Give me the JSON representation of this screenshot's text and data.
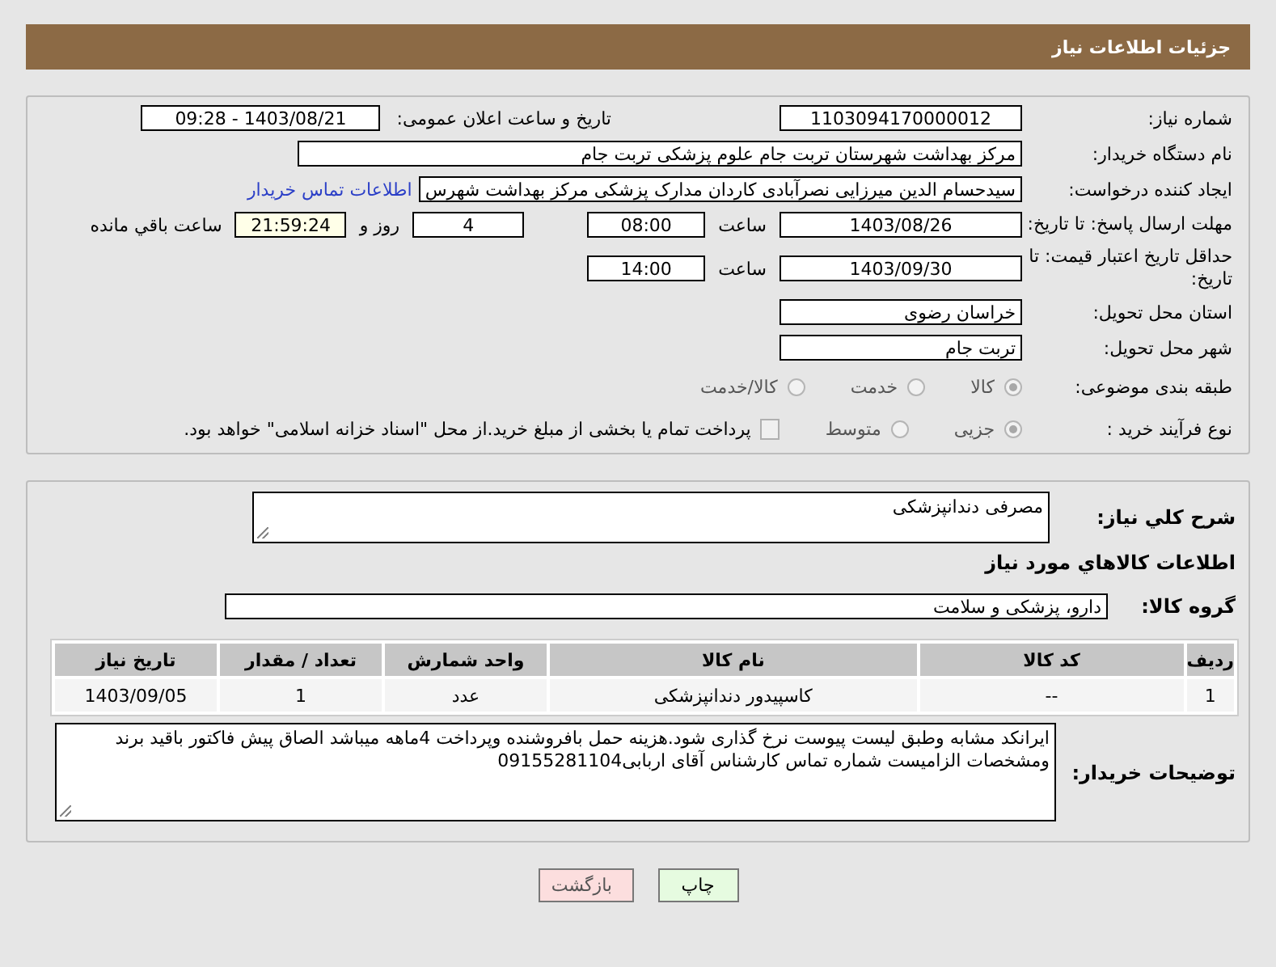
{
  "header": {
    "title": "جزئیات اطلاعات نیاز"
  },
  "need_info": {
    "need_number": {
      "label": "شماره نیاز:",
      "value": "1103094170000012"
    },
    "announce": {
      "label": "تاریخ و ساعت اعلان عمومی:",
      "value": "1403/08/21 - 09:28"
    },
    "buyer": {
      "label": "نام دستگاه خریدار:",
      "value": "مرکز بهداشت شهرستان تربت جام  علوم پزشکی تربت جام"
    },
    "creator": {
      "label": "ایجاد کننده درخواست:",
      "value": "سیدحسام الدین میرزایی نصرآبادی کاردان مدارک پزشکی مرکز بهداشت شهرس",
      "link": "اطلاعات تماس خریدار"
    },
    "deadline": {
      "label": "مهلت ارسال پاسخ: تا تاریخ:",
      "date": "1403/08/26",
      "time_label": "ساعت",
      "time": "08:00",
      "days": "4",
      "days_label": "روز و",
      "remaining": "21:59:24",
      "remaining_label": "ساعت باقي مانده"
    },
    "validity": {
      "label": "حداقل تاریخ اعتبار قیمت: تا تاریخ:",
      "date": "1403/09/30",
      "time_label": "ساعت",
      "time": "14:00"
    },
    "province": {
      "label": "استان محل تحویل:",
      "value": "خراسان رضوی"
    },
    "city": {
      "label": "شهر محل تحویل:",
      "value": "تربت جام"
    },
    "category": {
      "label": "طبقه بندی موضوعی:",
      "options": [
        {
          "label": "کالا",
          "selected": true
        },
        {
          "label": "خدمت",
          "selected": false
        },
        {
          "label": "کالا/خدمت",
          "selected": false
        }
      ]
    },
    "process": {
      "label": "نوع فرآیند خرید :",
      "options": [
        {
          "label": "جزیی",
          "selected": true
        },
        {
          "label": "متوسط",
          "selected": false
        }
      ],
      "payment": {
        "checked": false,
        "text": "پرداخت تمام یا بخشی از مبلغ خرید.از محل \"اسناد خزانه اسلامی\" خواهد بود."
      }
    }
  },
  "details": {
    "description": {
      "label": "شرح کلي نیاز:",
      "value": "مصرفی دندانپزشکی"
    },
    "goods_heading": "اطلاعات کالاهاي مورد نیاز",
    "group": {
      "label": "گروه کالا:",
      "value": "دارو، پزشکی و سلامت"
    },
    "table": {
      "columns": [
        "ردیف",
        "کد کالا",
        "نام کالا",
        "واحد شمارش",
        "تعداد / مقدار",
        "تاریخ نیاز"
      ],
      "rows": [
        [
          "1",
          "--",
          "کاسپیدور دندانپزشکی",
          "عدد",
          "1",
          "1403/09/05"
        ]
      ]
    },
    "buyer_notes": {
      "label": "توضیحات خریدار:",
      "value": "ایرانکد مشابه وطبق لیست پیوست نرخ گذاری شود.هزینه حمل بافروشنده وپرداخت 4ماهه میباشد الصاق پیش فاکتور باقید برند ومشخصات الزامیست شماره تماس کارشناس آقای اربابی09155281104"
    }
  },
  "buttons": [
    {
      "label": "چاپ",
      "kind": "print"
    },
    {
      "label": "بازگشت",
      "kind": "back"
    }
  ]
}
